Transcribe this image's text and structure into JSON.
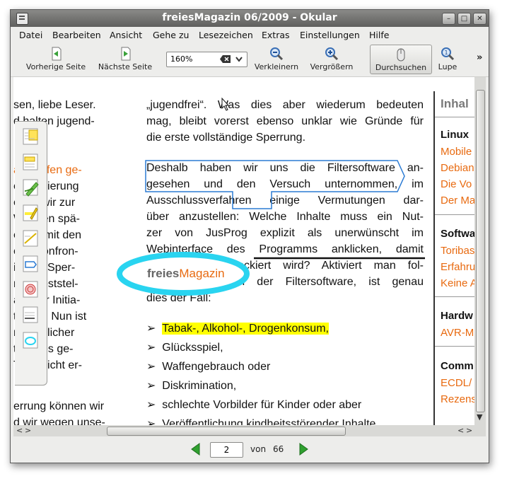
{
  "window": {
    "title": "freiesMagazin 06/2009 - Okular"
  },
  "menu": [
    "Datei",
    "Bearbeiten",
    "Ansicht",
    "Gehe zu",
    "Lesezeichen",
    "Extras",
    "Einstellungen",
    "Hilfe"
  ],
  "toolbar": {
    "prev_label": "Vorherige Seite",
    "next_label": "Nächste Seite",
    "zoom_value": "160%",
    "zoom_out_label": "Verkleinern",
    "zoom_in_label": "Vergrößern",
    "browse_label": "Durchsuchen",
    "magnifier_label": "Lupe",
    "more": "»"
  },
  "left_column": [
    "sen, liebe Leser.",
    "d halten jugend-",
    "",
    "",
    "azin offen ge-",
    "er Regierung",
    "ehen wir zur",
    "Wochen spä-",
    "e Mal mit den",
    "erre konfron-",
    "ir eine Sper-",
    "n.de feststel-",
    "are der Initia-",
    "tag [1]. Nun ist",
    "n staatlicher",
    "tzer des ge-",
    "Tage nicht er-",
    "",
    "errung können wir",
    "d wir wegen unse-"
  ],
  "main_column": {
    "para1": [
      "„jugendfrei“. Was dies aber wiederum bedeuten",
      "mag, bleibt vorerst ebenso unklar wie Gründe für",
      "die erste vollständige Sperrung."
    ],
    "para2": [
      "Deshalb haben wir uns die Filtersoftware an-",
      "gesehen und den Versuch unternommen, im",
      "Ausschlussverfahren einige Vermutungen dar-",
      "über anzustellen: Welche Inhalte muss ein Nut-",
      "zer von JusProg explizit als unerwünscht im",
      "Webinterface des Programms anklicken, damit",
      "freiesMagazin blockiert wird? Aktiviert man fol-",
      "gende Kategorien der Filtersoftware, ist genau",
      "dies der Fall:"
    ],
    "bullet_glyph": "➢",
    "bullets": [
      "Tabak-, Alkohol-, Drogenkonsum,",
      "Glücksspiel,",
      "Waffengebrauch oder",
      "Diskrimination,",
      "schlechte Vorbilder für Kinder oder aber",
      "Veröffentlichung kindheitsstörender Inhalte"
    ]
  },
  "stamp": {
    "part1": "freies",
    "part2": "Magazin"
  },
  "sidebar": {
    "title": "Inhal",
    "sections": [
      {
        "heading": "Linux",
        "links": [
          "Mobile",
          "Debian",
          "Die Vo",
          "Der Ma"
        ]
      },
      {
        "heading": "Softwa",
        "links": [
          "Toribas",
          "Erfahru",
          "Keine A"
        ]
      },
      {
        "heading": "Hardw",
        "links": [
          "AVR-M"
        ]
      },
      {
        "heading": "Comm",
        "links": [
          "ECDL/",
          "Rezens"
        ]
      }
    ]
  },
  "pagination": {
    "current": "2",
    "of_label": "von",
    "total": "66"
  },
  "colors": {
    "accent_orange": "#e86a10",
    "highlight_yellow": "#ffff00",
    "box_blue": "#2b7bd4",
    "ellipse_cyan": "#29d4f0",
    "nav_green": "#2fa02f"
  }
}
